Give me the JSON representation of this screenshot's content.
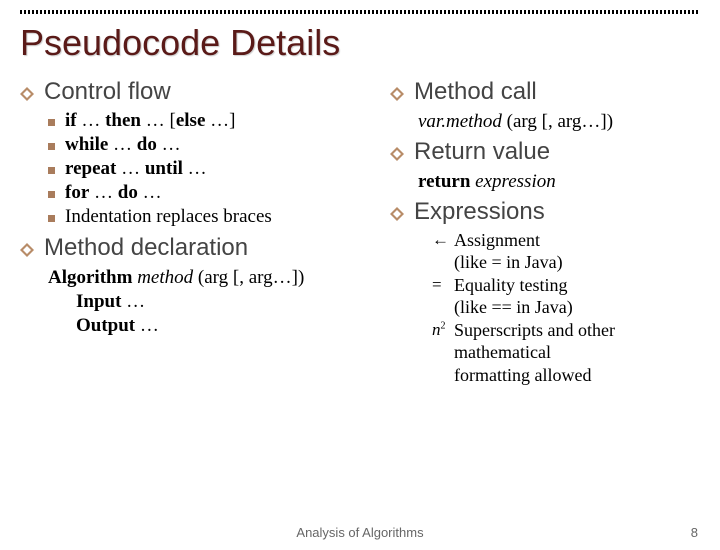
{
  "title": "Pseudocode Details",
  "left": {
    "control_flow": "Control flow",
    "cf_items": {
      "if": {
        "b1": "if",
        "t1": " … ",
        "b2": "then",
        "t2": " … [",
        "b3": "else",
        "t3": " …]"
      },
      "while": {
        "b1": "while",
        "t1": " … ",
        "b2": "do",
        "t2": " …"
      },
      "repeat": {
        "b1": "repeat",
        "t1": " … ",
        "b2": "until",
        "t2": " …"
      },
      "for": {
        "b1": "for",
        "t1": " … ",
        "b2": "do",
        "t2": " …"
      },
      "indent": "Indentation replaces braces"
    },
    "method_decl": "Method declaration",
    "decl": {
      "alg": "Algorithm",
      "method_i": "method",
      "args": " (arg [, arg…])",
      "input": "Input",
      "input_t": " …",
      "output": "Output",
      "output_t": " …"
    }
  },
  "right": {
    "method_call": "Method call",
    "call_line": {
      "var_i": "var.method",
      "args": " (arg [, arg…])"
    },
    "return_value": "Return value",
    "return_line": {
      "b": "return",
      "expr_i": "expression"
    },
    "expressions": "Expressions",
    "exprs": {
      "assign": {
        "sym": "←",
        "l1": "Assignment",
        "l2": "(like = in Java)"
      },
      "eq": {
        "sym": "=",
        "l1": "Equality testing",
        "l2": "(like == in Java)"
      },
      "sup": {
        "base": "n",
        "sup": "2",
        "l1": "Superscripts and other",
        "l2": "mathematical",
        "l3": "formatting allowed"
      }
    }
  },
  "footer": "Analysis of Algorithms",
  "page": "8"
}
